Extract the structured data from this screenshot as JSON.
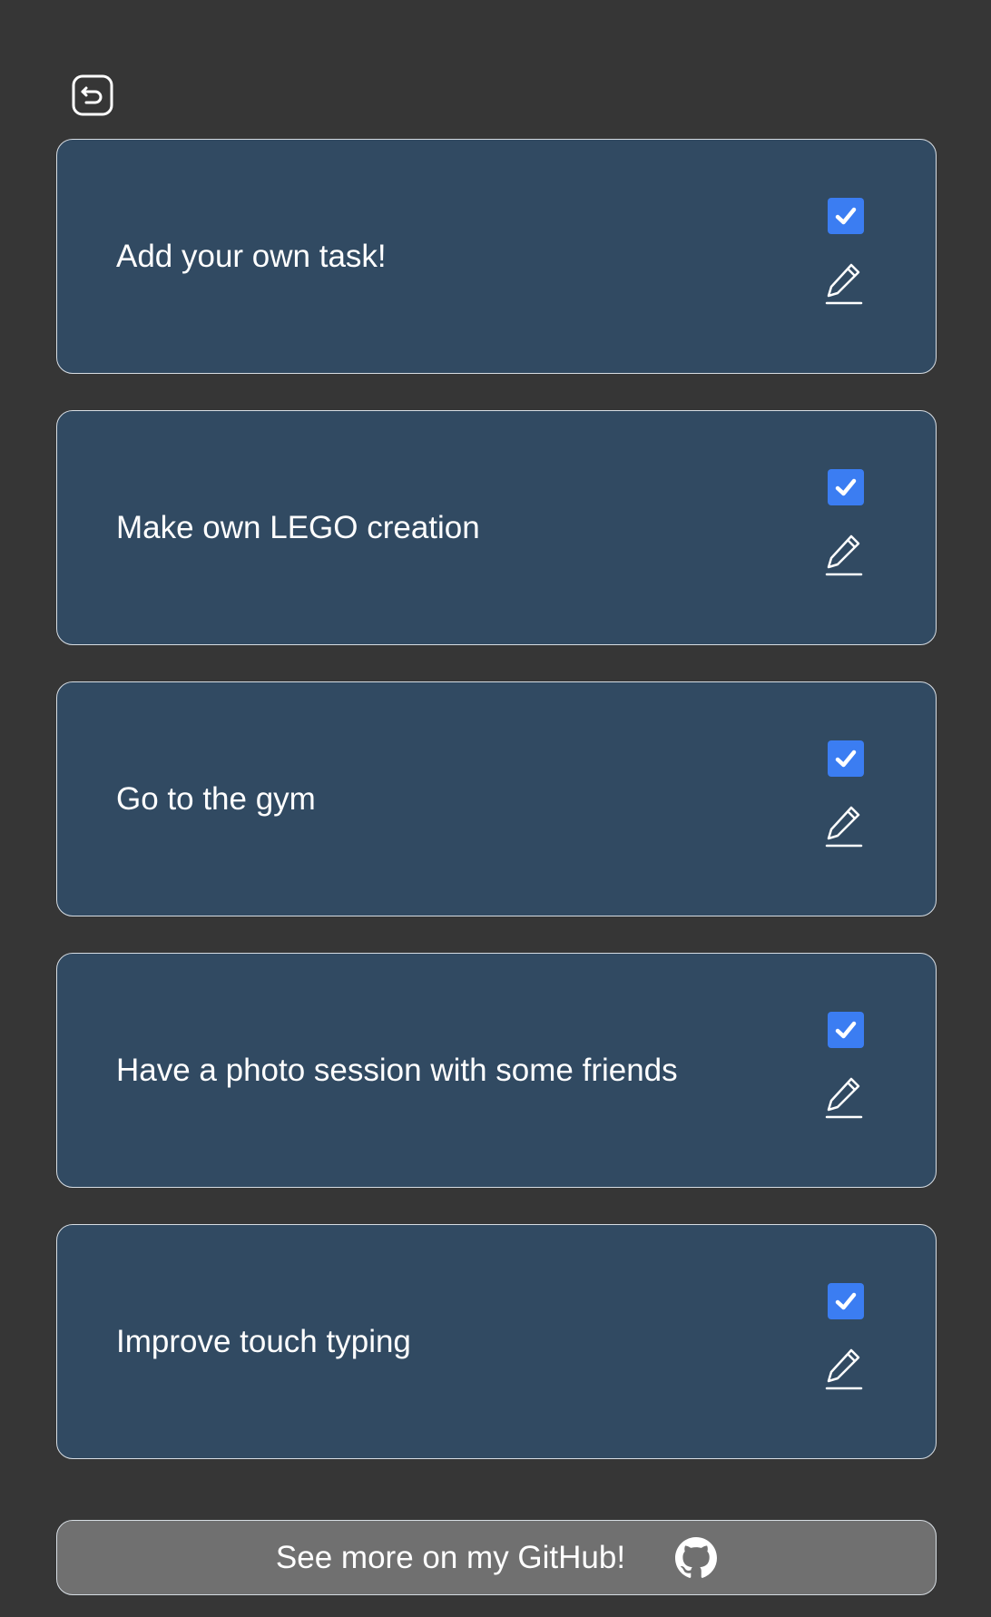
{
  "header": {
    "back_icon": "undo-arrow-icon"
  },
  "tasks": [
    {
      "label": "Add your own task!",
      "done": true
    },
    {
      "label": "Make own LEGO creation",
      "done": true
    },
    {
      "label": "Go to the gym",
      "done": true
    },
    {
      "label": "Have a photo session with some friends",
      "done": true
    },
    {
      "label": "Improve touch typing",
      "done": true
    }
  ],
  "footer": {
    "github_label": "See more on my GitHub!",
    "github_icon": "github-icon"
  },
  "colors": {
    "background": "#363636",
    "card": "#314a62",
    "card_border": "#d7dde3",
    "checkbox": "#3b7df2",
    "footer_button": "#707070",
    "text": "#ffffff"
  }
}
